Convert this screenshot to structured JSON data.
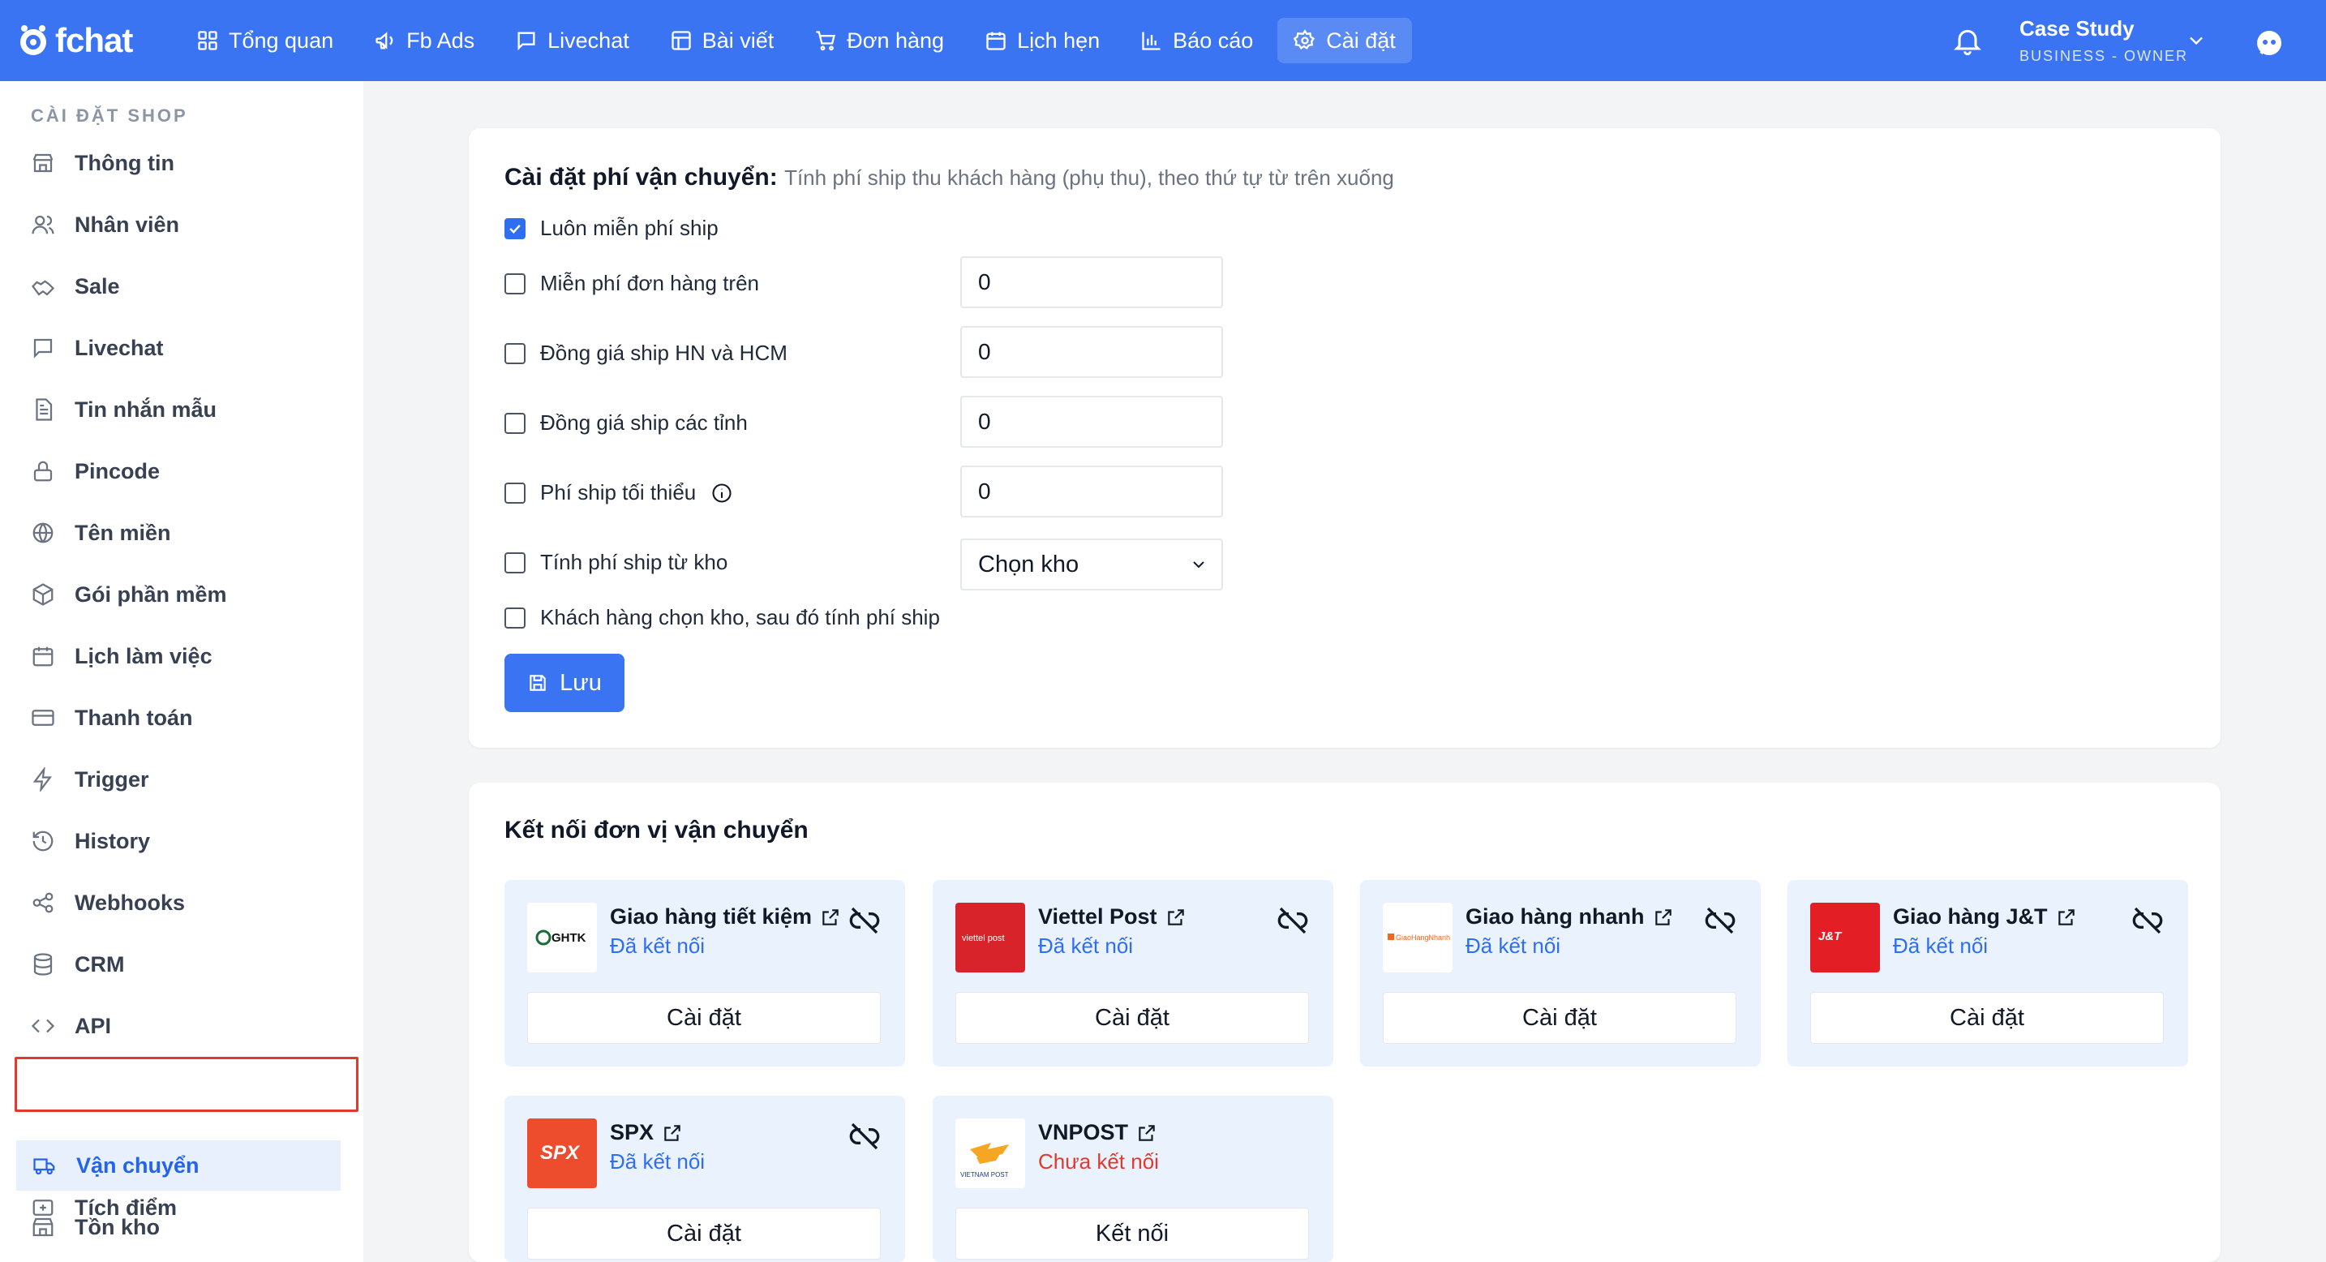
{
  "app": {
    "logo_text": "fchat"
  },
  "nav": [
    {
      "label": "Tổng quan",
      "icon": "grid-icon"
    },
    {
      "label": "Fb Ads",
      "icon": "megaphone-icon"
    },
    {
      "label": "Livechat",
      "icon": "chat-icon"
    },
    {
      "label": "Bài viết",
      "icon": "post-icon"
    },
    {
      "label": "Đơn hàng",
      "icon": "cart-icon"
    },
    {
      "label": "Lịch hẹn",
      "icon": "calendar-icon"
    },
    {
      "label": "Báo cáo",
      "icon": "bar-chart-icon"
    },
    {
      "label": "Cài đặt",
      "icon": "gear-icon",
      "active": true
    }
  ],
  "account": {
    "name": "Case Study",
    "role": "BUSINESS - OWNER"
  },
  "sidebar": {
    "section": "CÀI ĐẶT SHOP",
    "items": [
      {
        "label": "Thông tin",
        "icon": "store-icon"
      },
      {
        "label": "Nhân viên",
        "icon": "users-icon"
      },
      {
        "label": "Sale",
        "icon": "handshake-icon"
      },
      {
        "label": "Livechat",
        "icon": "chat-icon"
      },
      {
        "label": "Tin nhắn mẫu",
        "icon": "document-icon"
      },
      {
        "label": "Pincode",
        "icon": "lock-icon"
      },
      {
        "label": "Tên miền",
        "icon": "globe-icon"
      },
      {
        "label": "Gói phần mềm",
        "icon": "package-icon"
      },
      {
        "label": "Lịch làm việc",
        "icon": "calendar-icon"
      },
      {
        "label": "Thanh toán",
        "icon": "card-icon"
      },
      {
        "label": "Trigger",
        "icon": "bolt-icon"
      },
      {
        "label": "History",
        "icon": "history-icon"
      },
      {
        "label": "Webhooks",
        "icon": "share-icon"
      },
      {
        "label": "CRM",
        "icon": "database-icon"
      },
      {
        "label": "API",
        "icon": "code-icon"
      },
      {
        "label": "Vận chuyển",
        "icon": "truck-icon",
        "active": true
      },
      {
        "label": "Tồn kho",
        "icon": "warehouse-icon"
      },
      {
        "label": "Tích điểm",
        "icon": "points-icon"
      }
    ]
  },
  "shipping_fee": {
    "title": "Cài đặt phí vận chuyển:",
    "subtitle": "Tính phí ship thu khách hàng (phụ thu), theo thứ tự từ trên xuống",
    "options": [
      {
        "label": "Luôn miễn phí ship",
        "checked": true
      },
      {
        "label": "Miễn phí đơn hàng trên",
        "checked": false,
        "value": "0"
      },
      {
        "label": "Đồng giá ship HN và HCM",
        "checked": false,
        "value": "0"
      },
      {
        "label": "Đồng giá ship các tỉnh",
        "checked": false,
        "value": "0"
      },
      {
        "label": "Phí ship tối thiểu",
        "checked": false,
        "value": "0"
      },
      {
        "label": "Tính phí ship từ kho",
        "checked": false,
        "select": "Chọn kho"
      },
      {
        "label": "Khách hàng chọn kho, sau đó tính phí ship",
        "checked": false
      }
    ],
    "save_label": "Lưu"
  },
  "carriers": {
    "title": "Kết nối đơn vị vận chuyển",
    "items": [
      {
        "name": "Giao hàng tiết kiệm",
        "status": "Đã kết nối",
        "connected": true,
        "button": "Cài đặt",
        "logo_text": "GHTK",
        "logo_bg": "#ffffff",
        "logo_color": "#1b6b34"
      },
      {
        "name": "Viettel Post",
        "status": "Đã kết nối",
        "connected": true,
        "button": "Cài đặt",
        "logo_text": "viettel post",
        "logo_bg": "#d8232a",
        "logo_color": "#ffffff"
      },
      {
        "name": "Giao hàng nhanh",
        "status": "Đã kết nối",
        "connected": true,
        "button": "Cài đặt",
        "logo_text": "GiaoHangNhanh",
        "logo_bg": "#ffffff",
        "logo_color": "#f26522"
      },
      {
        "name": "Giao hàng J&T",
        "status": "Đã kết nối",
        "connected": true,
        "button": "Cài đặt",
        "logo_text": "J&T EXPRESS",
        "logo_bg": "#e31e24",
        "logo_color": "#ffffff"
      },
      {
        "name": "SPX",
        "status": "Đã kết nối",
        "connected": true,
        "button": "Cài đặt",
        "logo_text": "SPX",
        "logo_bg": "#ee4d2d",
        "logo_color": "#ffffff"
      },
      {
        "name": "VNPOST",
        "status": "Chưa kết nối",
        "connected": false,
        "button": "Kết nối",
        "logo_text": "VIETNAM POST",
        "logo_bg": "#ffffff",
        "logo_color": "#1d3a8a"
      }
    ]
  },
  "colors": {
    "primary": "#3b74f2",
    "connected": "#2f6fef",
    "disconnected": "#e03a2f",
    "card_bg": "#eaf2fd"
  }
}
